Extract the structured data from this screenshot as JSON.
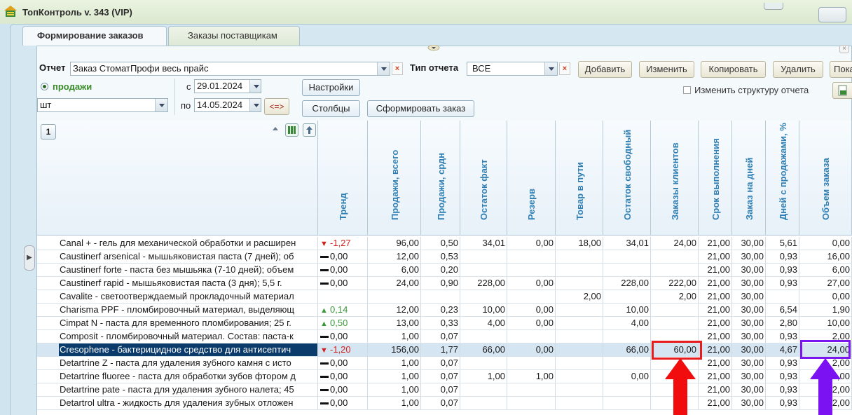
{
  "window": {
    "title": "ТопКонтроль v. 343 (VIP)"
  },
  "tabs": [
    "Формирование заказов",
    "Заказы поставщикам"
  ],
  "toolbar": {
    "report_label": "Отчет",
    "report_value": "Заказ СтоматПрофи весь прайс",
    "report_type_label": "Тип отчета",
    "report_type_value": "ВСЕ",
    "add_label": "Добавить",
    "edit_label": "Изменить",
    "copy_label": "Копировать",
    "delete_label": "Удалить",
    "show_label": "Пока",
    "sales_label": "продажи",
    "unit_value": "шт",
    "from_label": "с",
    "from_date": "29.01.2024",
    "to_label": "по",
    "to_date": "14.05.2024",
    "swap_label": "<=>",
    "settings_label": "Настройки",
    "columns_label": "Столбцы",
    "form_order_label": "Сформировать заказ",
    "change_structure_label": "Изменить структуру отчета"
  },
  "grid": {
    "group_level": "1",
    "columns": [
      "Тренд",
      "Продажи, всего",
      "Продажи, срдн",
      "Остаток факт",
      "Резерв",
      "Товар в пути",
      "Остаток свободный",
      "Заказы клиентов",
      "Срок выполнения",
      "Заказ на дней",
      "Дней с продажами, %",
      "Объем заказа"
    ],
    "rows": [
      {
        "name": "Canal + - гель для механической обработки и расширен",
        "trend_dir": "down",
        "trend": "-1,27",
        "v": [
          "96,00",
          "0,50",
          "34,01",
          "0,00",
          "18,00",
          "34,01",
          "24,00",
          "21,00",
          "30,00",
          "5,61",
          "0,00"
        ]
      },
      {
        "name": "Caustinerf arsenical - мышьяковистая паста (7 дней); об",
        "trend_dir": "flat",
        "trend": "0,00",
        "v": [
          "12,00",
          "0,53",
          "",
          "",
          "",
          "",
          "",
          "21,00",
          "30,00",
          "0,93",
          "16,00"
        ]
      },
      {
        "name": "Caustinerf forte - паста без мышьяка (7-10 дней); объем",
        "trend_dir": "flat",
        "trend": "0,00",
        "v": [
          "6,00",
          "0,20",
          "",
          "",
          "",
          "",
          "",
          "21,00",
          "30,00",
          "0,93",
          "6,00"
        ]
      },
      {
        "name": "Caustinerf rapid - мышьяковистая паста (3 дня); 5,5 г.",
        "trend_dir": "flat",
        "trend": "0,00",
        "v": [
          "24,00",
          "0,90",
          "228,00",
          "0,00",
          "",
          "228,00",
          "222,00",
          "21,00",
          "30,00",
          "0,93",
          "27,00"
        ]
      },
      {
        "name": "Cavalite - светоотверждаемый прокладочный материал",
        "trend_dir": "none",
        "trend": "",
        "v": [
          "",
          "",
          "",
          "",
          "2,00",
          "",
          "2,00",
          "21,00",
          "30,00",
          "",
          "0,00"
        ]
      },
      {
        "name": "Charisma PPF - пломбировочный материал, выделяющ",
        "trend_dir": "up",
        "trend": "0,14",
        "v": [
          "12,00",
          "0,23",
          "10,00",
          "0,00",
          "",
          "10,00",
          "",
          "21,00",
          "30,00",
          "6,54",
          "1,90"
        ]
      },
      {
        "name": "Cimpat N - паста для временного пломбирования; 25 г.",
        "trend_dir": "up",
        "trend": "0,50",
        "v": [
          "13,00",
          "0,33",
          "4,00",
          "0,00",
          "",
          "4,00",
          "",
          "21,00",
          "30,00",
          "2,80",
          "10,00"
        ]
      },
      {
        "name": "Composit - пломбировочный материал. Состав: паста-к",
        "trend_dir": "flat",
        "trend": "0,00",
        "v": [
          "1,00",
          "0,07",
          "",
          "",
          "",
          "",
          "",
          "21,00",
          "30,00",
          "0,93",
          "2,00"
        ]
      },
      {
        "name": "Cresophene - бактерицидное средство для антисептич",
        "trend_dir": "down",
        "trend": "-1,20",
        "v": [
          "156,00",
          "1,77",
          "66,00",
          "0,00",
          "",
          "66,00",
          "60,00",
          "21,00",
          "30,00",
          "4,67",
          "24,00"
        ],
        "selected": true
      },
      {
        "name": "Detartrine Z - паста для удаления зубного камня с исто",
        "trend_dir": "flat",
        "trend": "0,00",
        "v": [
          "1,00",
          "0,07",
          "",
          "",
          "",
          "",
          "",
          "21,00",
          "30,00",
          "0,93",
          "2,00"
        ]
      },
      {
        "name": "Detartrine fluoree - паста для обработки зубов фтором д",
        "trend_dir": "flat",
        "trend": "0,00",
        "v": [
          "1,00",
          "0,07",
          "1,00",
          "1,00",
          "",
          "0,00",
          "",
          "21,00",
          "30,00",
          "0,93",
          "3,00"
        ]
      },
      {
        "name": "Detartrine pate - паста для удаления зубного налета; 45",
        "trend_dir": "flat",
        "trend": "0,00",
        "v": [
          "1,00",
          "0,07",
          "",
          "",
          "",
          "",
          "",
          "21,00",
          "30,00",
          "0,93",
          "2,00"
        ]
      },
      {
        "name": "Detartrol ultra - жидкость для удаления зубных отложен",
        "trend_dir": "flat",
        "trend": "0,00",
        "v": [
          "1,00",
          "0,07",
          "",
          "",
          "",
          "",
          "",
          "21,00",
          "30,00",
          "0,93",
          "2,00"
        ]
      }
    ]
  },
  "colors": {
    "selected_row": "#0b3b6a",
    "header_text": "#2f7fb4",
    "highlight_red": "#e81c1c",
    "highlight_purple": "#7a17ef",
    "trend_up": "#3a9a3a",
    "trend_down": "#d02020"
  }
}
